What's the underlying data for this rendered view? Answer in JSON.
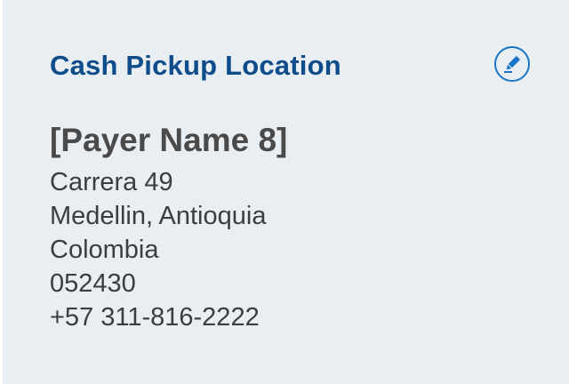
{
  "card": {
    "title": "Cash Pickup Location",
    "edit_icon": "pencil-edit-icon",
    "payer_name": "[Payer Name 8]",
    "address": {
      "street": "Carrera 49",
      "city_region": "Medellin, Antioquia",
      "country": "Colombia",
      "postal_code": "052430",
      "phone": "+57 311-816-2222"
    }
  },
  "colors": {
    "title": "#0f4c8a",
    "accent": "#1a73c9",
    "background": "#e9eef3",
    "text": "#3d3d3d"
  }
}
